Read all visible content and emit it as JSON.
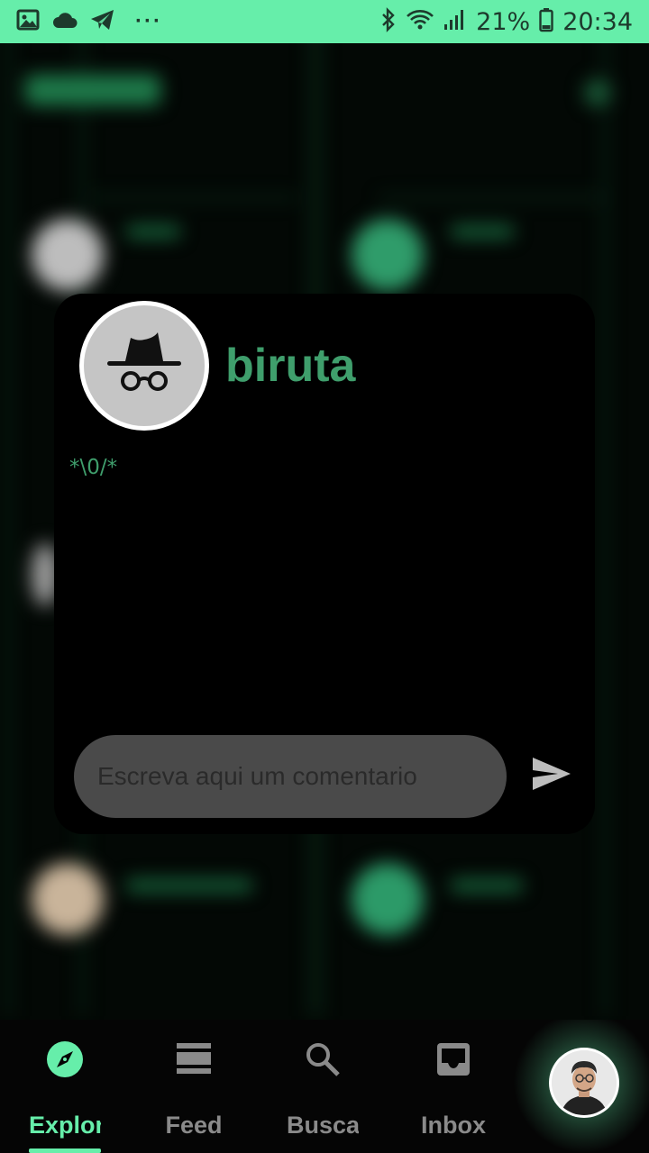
{
  "status_bar": {
    "battery": "21%",
    "time": "20:34",
    "more": "···",
    "icons": [
      "image-icon",
      "cloud-icon",
      "telegram-icon",
      "bluetooth-icon",
      "wifi-icon",
      "signal-icon",
      "battery-icon"
    ]
  },
  "background": {
    "title": "Explorar"
  },
  "dialog": {
    "username": "biruta",
    "bio": "*\\0/*",
    "comment_placeholder": "Escreva aqui um comentario",
    "avatar_icon": "incognito-icon",
    "send_icon": "send-icon"
  },
  "bottom_nav": {
    "items": [
      {
        "label": "Explorar",
        "icon": "compass-icon",
        "active": true
      },
      {
        "label": "Feed",
        "icon": "feed-icon",
        "active": false
      },
      {
        "label": "Busca",
        "icon": "search-icon",
        "active": false
      },
      {
        "label": "Inbox",
        "icon": "inbox-icon",
        "active": false
      }
    ],
    "profile_icon": "profile-avatar"
  },
  "colors": {
    "accent": "#66eeaa",
    "username": "#3f9e6c",
    "inactive": "#8a8a8a",
    "input_bg": "#4a4a4a"
  }
}
